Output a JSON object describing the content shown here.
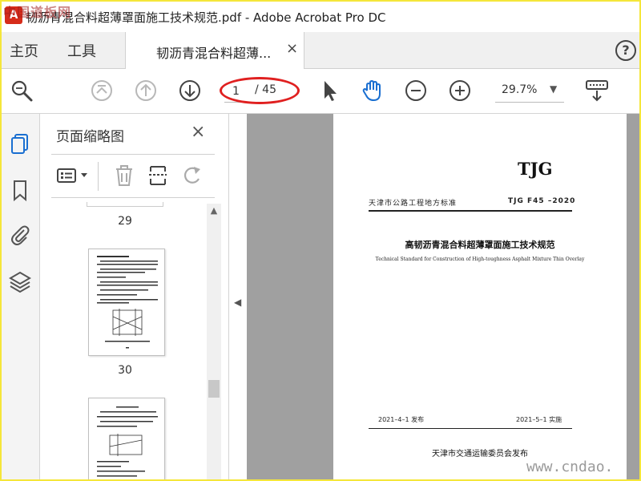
{
  "watermark_top": "中国道板网",
  "window": {
    "title": "韧沥青混合料超薄罩面施工技术规范.pdf - Adobe Acrobat Pro DC"
  },
  "tabs": {
    "home": "主页",
    "tools": "工具",
    "document": "韧沥青混合料超薄...",
    "document_close": "×",
    "help": "?"
  },
  "toolbar": {
    "current_page": "1",
    "page_total": "/ 45",
    "zoom": "29.7%",
    "zoom_caret": "▼"
  },
  "panel": {
    "title": "页面缩略图",
    "close": "×",
    "thumbnails": [
      {
        "number": "29"
      },
      {
        "number": "30"
      }
    ]
  },
  "document": {
    "abbr": "TJG",
    "standard_type": "天津市公路工程地方标准",
    "standard_code": "TJG F45 –2020",
    "title_cn": "高韧沥青混合料超薄罩面施工技术规范",
    "title_en": "Technical Standard for Construction of High-toughness Asphalt Mixture Thin Overlay",
    "issue_date": "2021–4–1 发布",
    "implement_date": "2021–5–1 实施",
    "publisher": "天津市交通运输委员会发布"
  },
  "watermark_bottom": "www.cndao.",
  "colors": {
    "highlight_oval": "#e02020",
    "hand_tool": "#1a6fd1",
    "doc_background": "#a0a0a0",
    "frame": "#f5e63a"
  }
}
